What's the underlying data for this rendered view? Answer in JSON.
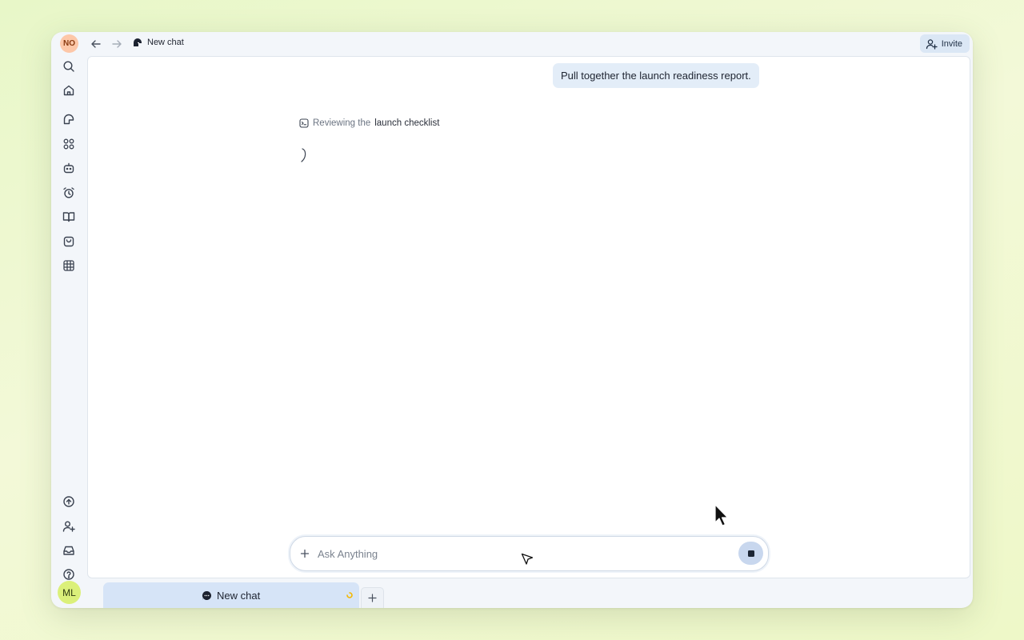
{
  "window": {
    "org_initials": "NO",
    "title": "New chat",
    "invite_label": "Invite"
  },
  "sidebar": {
    "top_icons": [
      "search-icon",
      "home-icon",
      "chat-icon",
      "apps-icon",
      "robot-icon",
      "alarm-clock-icon",
      "book-icon",
      "bag-icon",
      "table-icon"
    ],
    "bottom_icons": [
      "upgrade-icon",
      "add-user-icon",
      "inbox-icon",
      "help-icon",
      "settings-icon"
    ],
    "user_initials": "ML"
  },
  "conversation": {
    "user_message": "Pull together the launch readiness report.",
    "status_prefix": "Reviewing the",
    "status_emphasis": "launch checklist"
  },
  "composer": {
    "placeholder": "Ask Anything",
    "value": ""
  },
  "tabs": {
    "active_tab_label": "New chat"
  },
  "colors": {
    "accent_light": "#d6e4f7",
    "bubble": "#e3edf8",
    "org_badge": "#fdc7a8",
    "user_avatar": "#dbf07a",
    "spinner": "#f5b800"
  }
}
